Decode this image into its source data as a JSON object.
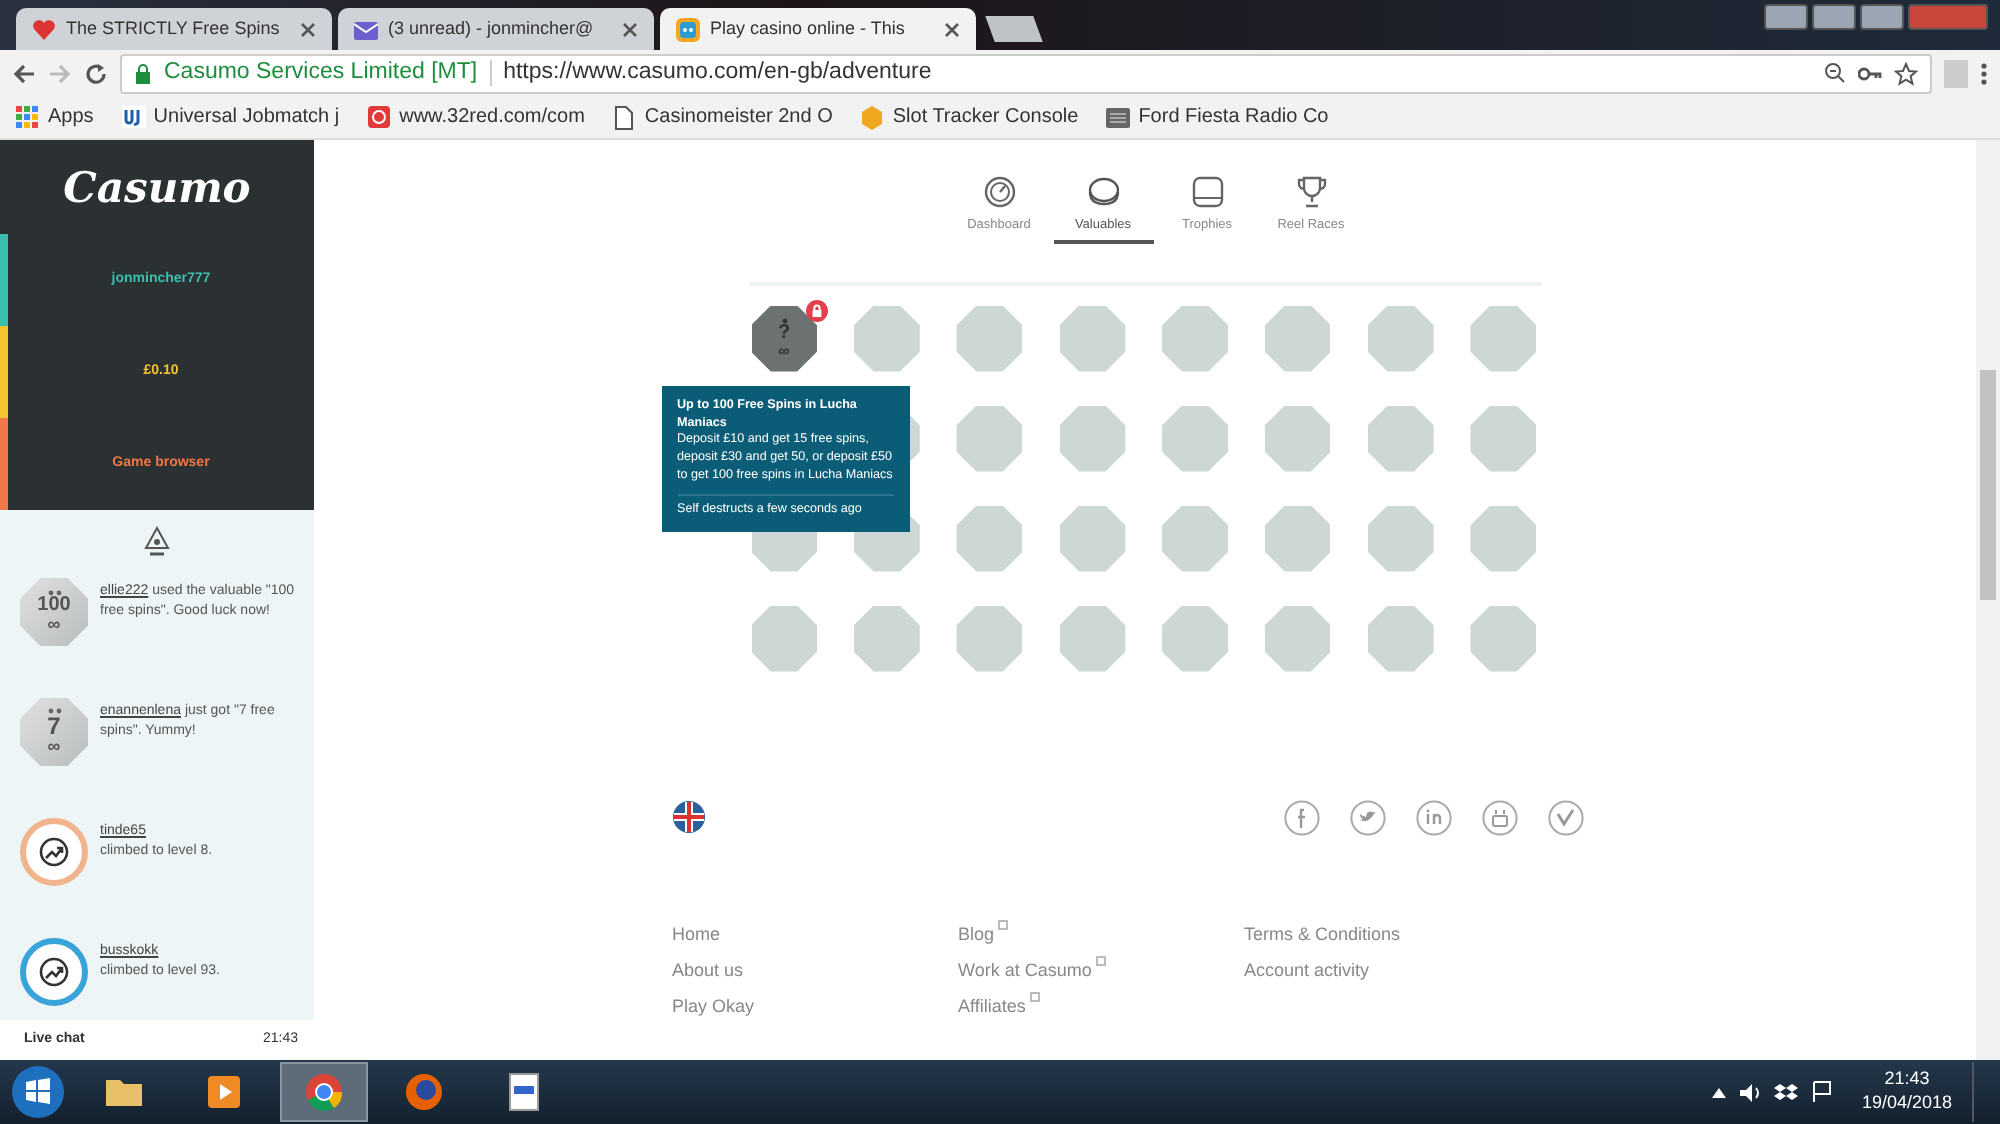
{
  "browser": {
    "tabs": [
      {
        "title": "The STRICTLY Free Spins",
        "kind": "heart",
        "selected": false
      },
      {
        "title": "(3 unread) - jonmincher@",
        "kind": "mail",
        "selected": false
      },
      {
        "title": "Play casino online - This",
        "kind": "app",
        "selected": true
      }
    ],
    "address_bar": {
      "site_name": "Casumo Services Limited [MT]",
      "url": "https://www.casumo.com/en-gb/adventure"
    },
    "bookmarks": [
      {
        "label": "Apps",
        "kind": "apps"
      },
      {
        "label": "Universal Jobmatch j",
        "kind": "uj"
      },
      {
        "label": "www.32red.com/com",
        "kind": "red"
      },
      {
        "label": "Casinomeister 2nd O",
        "kind": "page"
      },
      {
        "label": "Slot Tracker Console",
        "kind": "badge"
      },
      {
        "label": "Ford Fiesta Radio Co",
        "kind": "radio"
      }
    ]
  },
  "sidebar": {
    "logo": "Casumo",
    "menu": [
      {
        "label": "jonmincher777",
        "color": "#3bbfad"
      },
      {
        "label": "£0.10",
        "color": "#f4c430"
      },
      {
        "label": "Game browser",
        "color": "#f07846"
      }
    ],
    "feed": [
      {
        "kind": "coin",
        "badge": "100",
        "symbol": "∞",
        "user": "ellie222",
        "text": " used the valuable \"100 free spins\". Good luck now!"
      },
      {
        "kind": "coin",
        "badge": "7",
        "symbol": "∞",
        "user": "enannenlena",
        "text": " just got \"7 free spins\". Yummy!"
      },
      {
        "kind": "level",
        "color": "#f2b48c",
        "user": "tinde65",
        "text": "climbed to level 8."
      },
      {
        "kind": "level",
        "color": "#3aa3d9",
        "user": "busskokk",
        "text": "climbed to level 93."
      }
    ],
    "live_chat": "Live chat",
    "time": "21:43"
  },
  "main": {
    "tabs": [
      {
        "label": "Dashboard",
        "kind": "gauge",
        "selected": false
      },
      {
        "label": "Valuables",
        "kind": "coin",
        "selected": true
      },
      {
        "label": "Trophies",
        "kind": "box",
        "selected": false
      },
      {
        "label": "Reel Races",
        "kind": "trophy",
        "selected": false
      }
    ],
    "valuables": [
      {
        "kind": "locked",
        "badge": "?",
        "symbol": "∞"
      },
      {
        "kind": "empty"
      },
      {
        "kind": "empty"
      },
      {
        "kind": "empty"
      },
      {
        "kind": "empty"
      },
      {
        "kind": "empty"
      },
      {
        "kind": "empty"
      },
      {
        "kind": "empty"
      },
      {
        "kind": "covered"
      },
      {
        "kind": "empty"
      },
      {
        "kind": "empty"
      },
      {
        "kind": "empty"
      },
      {
        "kind": "empty"
      },
      {
        "kind": "empty"
      },
      {
        "kind": "empty"
      },
      {
        "kind": "empty"
      },
      {
        "kind": "empty"
      },
      {
        "kind": "empty"
      },
      {
        "kind": "empty"
      },
      {
        "kind": "empty"
      },
      {
        "kind": "empty"
      },
      {
        "kind": "empty"
      },
      {
        "kind": "empty"
      },
      {
        "kind": "empty"
      },
      {
        "kind": "empty"
      },
      {
        "kind": "empty"
      },
      {
        "kind": "empty"
      },
      {
        "kind": "empty"
      },
      {
        "kind": "empty"
      },
      {
        "kind": "empty"
      },
      {
        "kind": "empty"
      },
      {
        "kind": "empty"
      }
    ],
    "tooltip": {
      "title": "Up to 100 Free Spins in Lucha Maniacs",
      "body": "Deposit £10 and get 15 free spins, deposit £30 and get 50, or deposit £50 to get 100 free spins in Lucha Maniacs",
      "footer": "Self destructs a few seconds ago"
    },
    "social": [
      {
        "kind": "facebook"
      },
      {
        "kind": "twitter"
      },
      {
        "kind": "linkedin"
      },
      {
        "kind": "youtube"
      },
      {
        "kind": "vimeo"
      }
    ],
    "footer_links": [
      [
        {
          "label": "Home",
          "external": false
        },
        {
          "label": "About us",
          "external": false
        },
        {
          "label": "Play Okay",
          "external": false
        }
      ],
      [
        {
          "label": "Blog",
          "external": true
        },
        {
          "label": "Work at Casumo",
          "external": true
        },
        {
          "label": "Affiliates",
          "external": true
        }
      ],
      [
        {
          "label": "Terms & Conditions",
          "external": false
        },
        {
          "label": "Account activity",
          "external": false
        }
      ]
    ]
  },
  "taskbar": {
    "apps": [
      {
        "kind": "folder",
        "selected": false
      },
      {
        "kind": "media",
        "selected": false
      },
      {
        "kind": "chrome",
        "selected": true
      },
      {
        "kind": "firefox",
        "selected": false
      },
      {
        "kind": "document",
        "selected": false
      }
    ],
    "time": "21:43",
    "date": "19/04/2018"
  }
}
